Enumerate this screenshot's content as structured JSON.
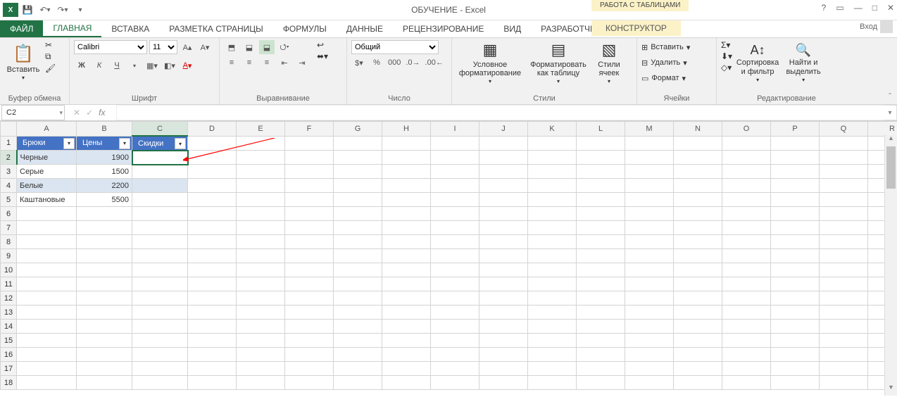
{
  "title": "ОБУЧЕНИЕ - Excel",
  "tabletools_label": "РАБОТА С ТАБЛИЦАМИ",
  "tabs": {
    "file": "ФАЙЛ",
    "home": "ГЛАВНАЯ",
    "insert": "ВСТАВКА",
    "layout": "РАЗМЕТКА СТРАНИЦЫ",
    "formulas": "ФОРМУЛЫ",
    "data": "ДАННЫЕ",
    "review": "РЕЦЕНЗИРОВАНИЕ",
    "view": "ВИД",
    "dev": "РАЗРАБОТЧИК",
    "design": "КОНСТРУКТОР"
  },
  "login": "Вход",
  "ribbon": {
    "clipboard": {
      "paste": "Вставить",
      "label": "Буфер обмена"
    },
    "font": {
      "name": "Calibri",
      "size": "11",
      "label": "Шрифт",
      "bold": "Ж",
      "italic": "К",
      "underline": "Ч"
    },
    "align": {
      "label": "Выравнивание"
    },
    "number": {
      "format": "Общий",
      "label": "Число"
    },
    "styles": {
      "cond": "Условное форматирование",
      "astable": "Форматировать как таблицу",
      "cellstyles": "Стили ячеек",
      "label": "Стили"
    },
    "cells": {
      "insert": "Вставить",
      "delete": "Удалить",
      "format": "Формат",
      "label": "Ячейки"
    },
    "editing": {
      "sort": "Сортировка и фильтр",
      "find": "Найти и выделить",
      "label": "Редактирование"
    }
  },
  "namebox": "C2",
  "columns": [
    "A",
    "B",
    "C",
    "D",
    "E",
    "F",
    "G",
    "H",
    "I",
    "J",
    "K",
    "L",
    "M",
    "N",
    "O",
    "P",
    "Q",
    "R"
  ],
  "rowcount": 18,
  "table": {
    "headers": [
      "Брюки",
      "Цены",
      "Скидки"
    ],
    "rows": [
      {
        "a": "Черные",
        "b": "1900",
        "c": ""
      },
      {
        "a": "Серые",
        "b": "1500",
        "c": ""
      },
      {
        "a": "Белые",
        "b": "2200",
        "c": ""
      },
      {
        "a": "Каштановые",
        "b": "5500",
        "c": ""
      }
    ]
  },
  "icons": {
    "help": "?",
    "wopts": "▭",
    "min": "—",
    "max": "□",
    "close": "✕",
    "dd": "▾",
    "chev": "ˇ"
  }
}
